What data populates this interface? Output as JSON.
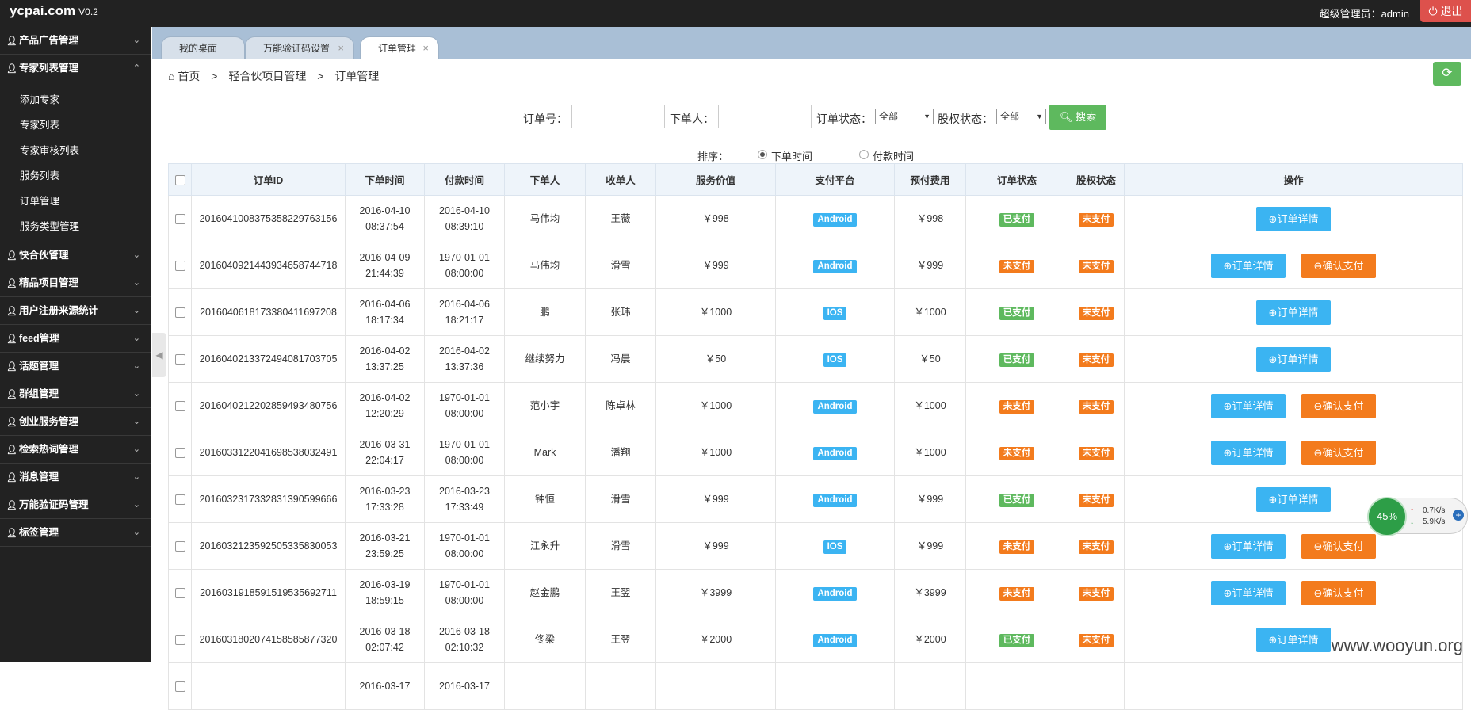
{
  "brand": {
    "name": "ycpai.com",
    "version": "V0.2"
  },
  "header": {
    "user_label": "超级管理员：admin",
    "logout_label": "退出"
  },
  "sidebar": {
    "groups": [
      {
        "label": "产品广告管理",
        "expanded": false
      },
      {
        "label": "专家列表管理",
        "expanded": true,
        "items": [
          "添加专家",
          "专家列表",
          "专家审核列表",
          "服务列表",
          "订单管理",
          "服务类型管理"
        ]
      },
      {
        "label": "快合伙管理",
        "expanded": false
      },
      {
        "label": "精品项目管理",
        "expanded": false
      },
      {
        "label": "用户注册来源统计",
        "expanded": false
      },
      {
        "label": "feed管理",
        "expanded": false
      },
      {
        "label": "话题管理",
        "expanded": false
      },
      {
        "label": "群组管理",
        "expanded": false
      },
      {
        "label": "创业服务管理",
        "expanded": false
      },
      {
        "label": "检索热词管理",
        "expanded": false
      },
      {
        "label": "消息管理",
        "expanded": false
      },
      {
        "label": "万能验证码管理",
        "expanded": false
      },
      {
        "label": "标签管理",
        "expanded": false
      }
    ]
  },
  "tabs": [
    {
      "label": "我的桌面",
      "active": false,
      "closable": false
    },
    {
      "label": "万能验证码设置",
      "active": false,
      "closable": true
    },
    {
      "label": "订单管理",
      "active": true,
      "closable": true
    }
  ],
  "breadcrumb": {
    "home": "首页",
    "level1": "轻合伙项目管理",
    "level2": "订单管理"
  },
  "search": {
    "order_no_label": "订单号：",
    "orderer_label": "下单人：",
    "order_status_label": "订单状态：",
    "order_status_value": "全部",
    "equity_status_label": "股权状态：",
    "equity_status_value": "全部",
    "button_label": "搜索"
  },
  "sort": {
    "label": "排序：",
    "option1": "下单时间",
    "option2": "付款时间"
  },
  "table": {
    "headers": [
      "订单ID",
      "下单时间",
      "付款时间",
      "下单人",
      "收单人",
      "服务价值",
      "支付平台",
      "预付费用",
      "订单状态",
      "股权状态",
      "操作"
    ],
    "detail_label": "订单详情",
    "confirm_label": "确认支付",
    "rows": [
      {
        "id": "2016041008375358229763156",
        "order_date": "2016-04-10",
        "order_time": "08:37:54",
        "pay_date": "2016-04-10",
        "pay_time": "08:39:10",
        "orderer": "马伟均",
        "receiver": "王薇",
        "value": "￥998",
        "platform": "Android",
        "prepay": "￥998",
        "order_status": "已支付",
        "equity_status": "未支付"
      },
      {
        "id": "2016040921443934658744718",
        "order_date": "2016-04-09",
        "order_time": "21:44:39",
        "pay_date": "1970-01-01",
        "pay_time": "08:00:00",
        "orderer": "马伟均",
        "receiver": "滑雪",
        "value": "￥999",
        "platform": "Android",
        "prepay": "￥999",
        "order_status": "未支付",
        "equity_status": "未支付"
      },
      {
        "id": "2016040618173380411697208",
        "order_date": "2016-04-06",
        "order_time": "18:17:34",
        "pay_date": "2016-04-06",
        "pay_time": "18:21:17",
        "orderer": "鹏",
        "receiver": "张玮",
        "value": "￥1000",
        "platform": "IOS",
        "prepay": "￥1000",
        "order_status": "已支付",
        "equity_status": "未支付"
      },
      {
        "id": "2016040213372494081703705",
        "order_date": "2016-04-02",
        "order_time": "13:37:25",
        "pay_date": "2016-04-02",
        "pay_time": "13:37:36",
        "orderer": "继续努力",
        "receiver": "冯晨",
        "value": "￥50",
        "platform": "IOS",
        "prepay": "￥50",
        "order_status": "已支付",
        "equity_status": "未支付"
      },
      {
        "id": "2016040212202859493480756",
        "order_date": "2016-04-02",
        "order_time": "12:20:29",
        "pay_date": "1970-01-01",
        "pay_time": "08:00:00",
        "orderer": "范小宇",
        "receiver": "陈卓林",
        "value": "￥1000",
        "platform": "Android",
        "prepay": "￥1000",
        "order_status": "未支付",
        "equity_status": "未支付"
      },
      {
        "id": "2016033122041698538032491",
        "order_date": "2016-03-31",
        "order_time": "22:04:17",
        "pay_date": "1970-01-01",
        "pay_time": "08:00:00",
        "orderer": "Mark",
        "receiver": "潘翔",
        "value": "￥1000",
        "platform": "Android",
        "prepay": "￥1000",
        "order_status": "未支付",
        "equity_status": "未支付"
      },
      {
        "id": "2016032317332831390599666",
        "order_date": "2016-03-23",
        "order_time": "17:33:28",
        "pay_date": "2016-03-23",
        "pay_time": "17:33:49",
        "orderer": "钟恒",
        "receiver": "滑雪",
        "value": "￥999",
        "platform": "Android",
        "prepay": "￥999",
        "order_status": "已支付",
        "equity_status": "未支付"
      },
      {
        "id": "2016032123592505335830053",
        "order_date": "2016-03-21",
        "order_time": "23:59:25",
        "pay_date": "1970-01-01",
        "pay_time": "08:00:00",
        "orderer": "江永升",
        "receiver": "滑雪",
        "value": "￥999",
        "platform": "IOS",
        "prepay": "￥999",
        "order_status": "未支付",
        "equity_status": "未支付"
      },
      {
        "id": "2016031918591519535692711",
        "order_date": "2016-03-19",
        "order_time": "18:59:15",
        "pay_date": "1970-01-01",
        "pay_time": "08:00:00",
        "orderer": "赵金鹏",
        "receiver": "王翌",
        "value": "￥3999",
        "platform": "Android",
        "prepay": "￥3999",
        "order_status": "未支付",
        "equity_status": "未支付"
      },
      {
        "id": "2016031802074158585877320",
        "order_date": "2016-03-18",
        "order_time": "02:07:42",
        "pay_date": "2016-03-18",
        "pay_time": "02:10:32",
        "orderer": "佟梁",
        "receiver": "王翌",
        "value": "￥2000",
        "platform": "Android",
        "prepay": "￥2000",
        "order_status": "已支付",
        "equity_status": "未支付"
      },
      {
        "id": "",
        "order_date": "2016-03-17",
        "order_time": "",
        "pay_date": "2016-03-17",
        "pay_time": "",
        "orderer": "",
        "receiver": "",
        "value": "",
        "platform": "",
        "prepay": "",
        "order_status": "",
        "equity_status": ""
      }
    ]
  },
  "speed_widget": {
    "percent": "45%",
    "up": "0.7K/s",
    "down": "5.9K/s"
  },
  "watermark": "www.wooyun.org",
  "colors": {
    "topbar": "#222222",
    "tabbar": "#a9bfd6",
    "blue": "#3bb4f2",
    "green": "#5eb95e",
    "orange": "#f37b1d",
    "logout": "#dd514c"
  }
}
